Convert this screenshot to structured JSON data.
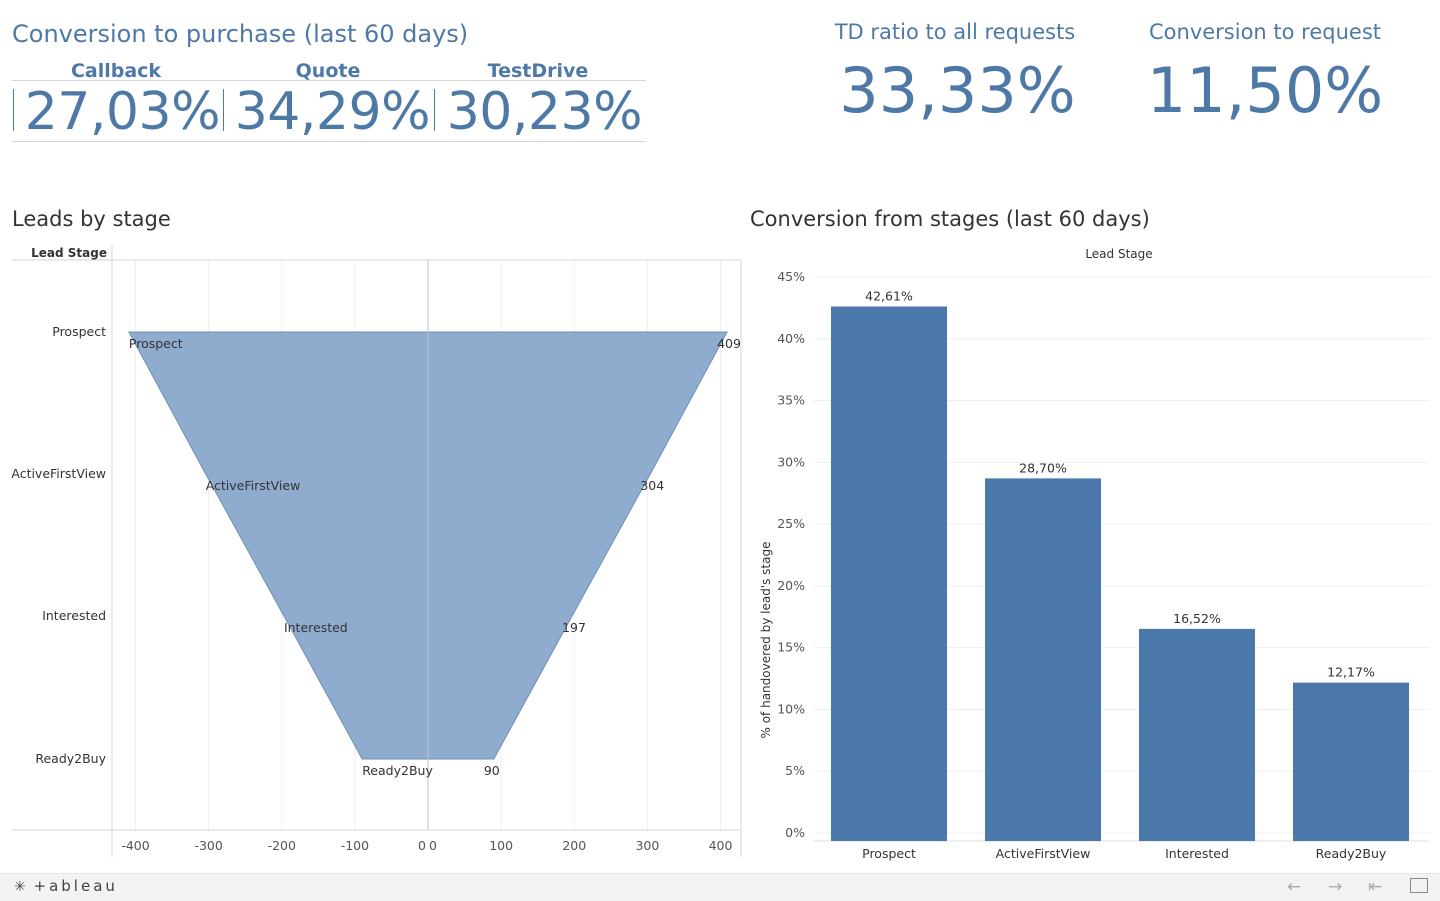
{
  "conversion_purchase": {
    "title": "Conversion to purchase (last 60 days)",
    "columns": [
      {
        "label": "Callback",
        "value": "27,03%"
      },
      {
        "label": "Quote",
        "value": "34,29%"
      },
      {
        "label": "TestDrive",
        "value": "30,23%"
      }
    ]
  },
  "td_ratio": {
    "title": "TD ratio to all requests",
    "value": "33,33%"
  },
  "conv_request": {
    "title": "Conversion to request",
    "value": "11,50%"
  },
  "chart_data": [
    {
      "type": "area",
      "title": "Leads by stage",
      "row_header": "Lead Stage",
      "categories": [
        "Prospect",
        "ActiveFirstView",
        "Interested",
        "Ready2Buy"
      ],
      "values": [
        409,
        304,
        197,
        90
      ],
      "value_labels": [
        "409",
        "304",
        "197",
        "90"
      ],
      "x_ticks_left": [
        "-400",
        "-300",
        "-200",
        "-100",
        "0"
      ],
      "x_ticks_right": [
        "0",
        "100",
        "200",
        "300",
        "400"
      ],
      "xlim": [
        -430,
        430
      ],
      "color": "#8facce"
    },
    {
      "type": "bar",
      "title": "Conversion from stages (last 60 days)",
      "column_header": "Lead Stage",
      "ylabel": "% of handovered by lead's stage",
      "categories": [
        "Prospect",
        "ActiveFirstView",
        "Interested",
        "Ready2Buy"
      ],
      "values": [
        42.61,
        28.7,
        16.52,
        12.17
      ],
      "value_labels": [
        "42,61%",
        "28,70%",
        "16,52%",
        "12,17%"
      ],
      "y_ticks": [
        "0%",
        "5%",
        "10%",
        "15%",
        "20%",
        "25%",
        "30%",
        "35%",
        "40%",
        "45%"
      ],
      "ylim": [
        0,
        45
      ],
      "color": "#4a78aa"
    }
  ],
  "footer": {
    "logo": "+ableau",
    "icons": [
      "undo-icon",
      "redo-icon",
      "revert-icon",
      "fullscreen-icon"
    ]
  }
}
